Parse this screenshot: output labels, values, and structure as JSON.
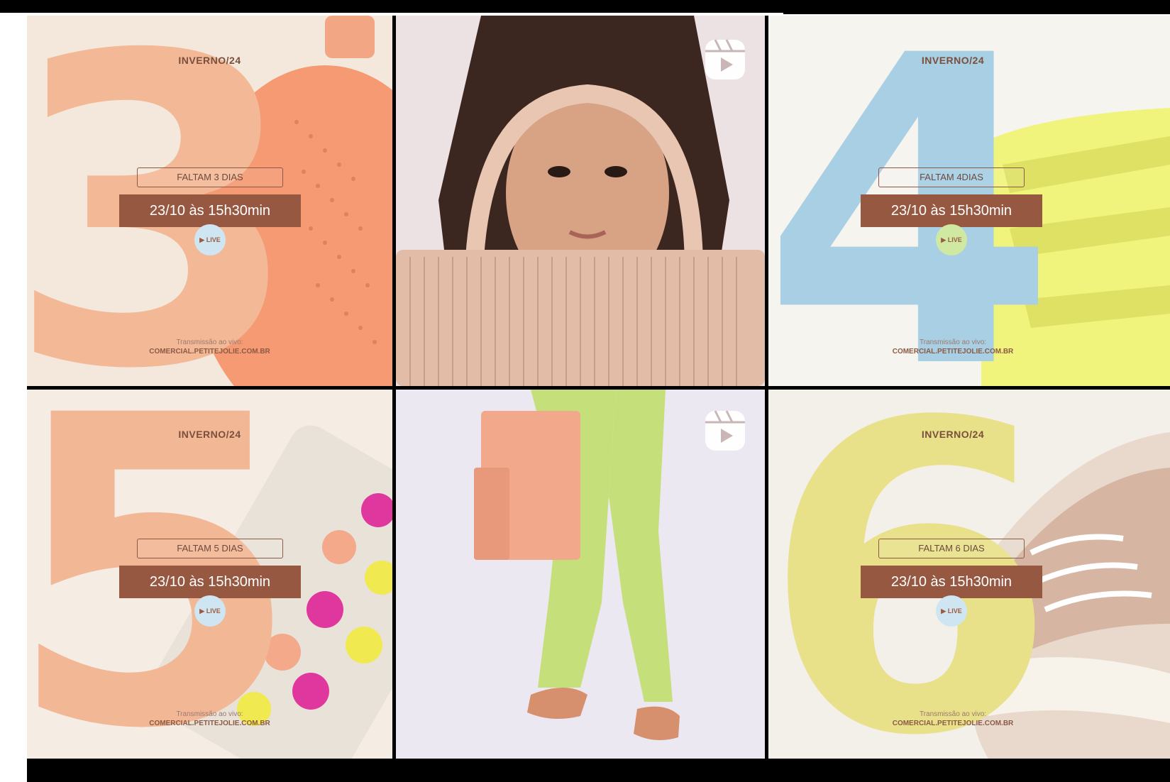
{
  "posts": [
    {
      "season": "INVERNO/24",
      "number": "3",
      "countdown": "FALTAM 3 DIAS",
      "date": "23/10 às 15h30min",
      "live": "▶ LIVE",
      "footer_line1": "Transmissão ao vivo:",
      "footer_line2": "COMERCIAL.PETITEJOLIE.COM.BR",
      "number_color": "#f3b997",
      "live_color": "#cfe6f2"
    },
    {
      "type": "reel",
      "icon": "reel-icon"
    },
    {
      "season": "INVERNO/24",
      "number": "4",
      "countdown": "FALTAM 4DIAS",
      "date": "23/10 às 15h30min",
      "live": "▶ LIVE",
      "footer_line1": "Transmissão ao vivo:",
      "footer_line2": "COMERCIAL.PETITEJOLIE.COM.BR",
      "number_color": "#a8cfe3",
      "live_color": "#cfe8a2"
    },
    {
      "season": "INVERNO/24",
      "number": "5",
      "countdown": "FALTAM 5 DIAS",
      "date": "23/10 às 15h30min",
      "live": "▶ LIVE",
      "footer_line1": "Transmissão ao vivo:",
      "footer_line2": "COMERCIAL.PETITEJOLIE.COM.BR",
      "number_color": "#f2b795",
      "live_color": "#cfe6f2"
    },
    {
      "type": "reel",
      "icon": "reel-icon"
    },
    {
      "season": "INVERNO/24",
      "number": "6",
      "countdown": "FALTAM 6 DIAS",
      "date": "23/10 às 15h30min",
      "live": "▶ LIVE",
      "footer_line1": "Transmissão ao vivo:",
      "footer_line2": "COMERCIAL.PETITEJOLIE.COM.BR",
      "number_color": "#e8e18a",
      "live_color": "#cfe6f2"
    }
  ],
  "colors": {
    "brand_brown": "#975842",
    "text_brown": "#7a4f3c"
  }
}
